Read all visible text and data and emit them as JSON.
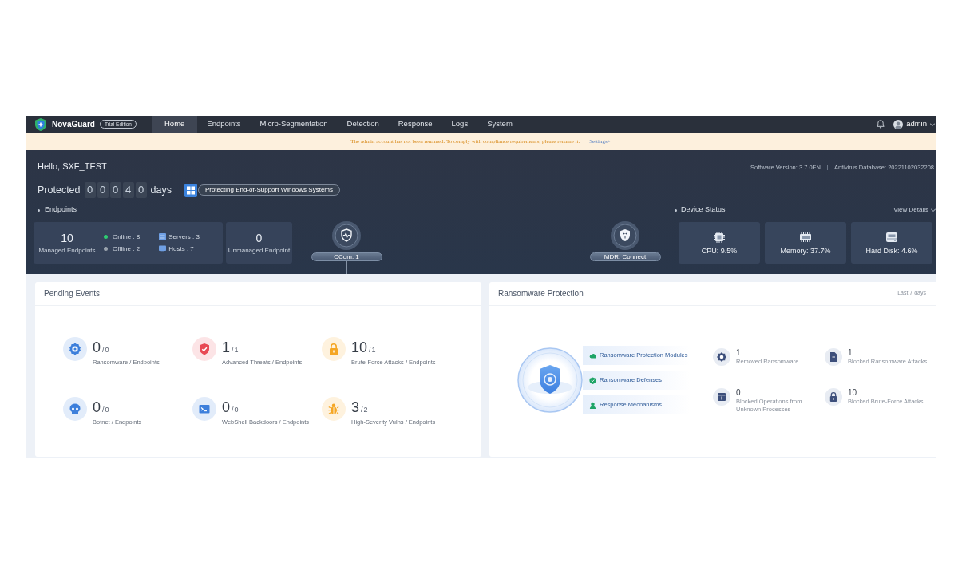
{
  "navbar": {
    "brand": "NovaGuard",
    "edition": "Trial Edition",
    "tabs": [
      {
        "label": "Home",
        "selected": true
      },
      {
        "label": "Endpoints",
        "selected": false
      },
      {
        "label": "Micro-Segmentation",
        "selected": false
      },
      {
        "label": "Detection",
        "selected": false
      },
      {
        "label": "Response",
        "selected": false
      },
      {
        "label": "Logs",
        "selected": false
      },
      {
        "label": "System",
        "selected": false
      }
    ],
    "user": "admin"
  },
  "notice": {
    "message": "The admin account has not been renamed. To comply with compliance requirements, please rename it.",
    "link": "Settings>"
  },
  "overview": {
    "greeting": "Hello, SXF_TEST",
    "software_version": "Software Version: 3.7.0EN",
    "antivirus_database": "Antivirus Database: 20221102032208",
    "protected": {
      "label": "Protected",
      "digits": [
        "0",
        "0",
        "0",
        "4",
        "0"
      ],
      "unit": "days"
    },
    "support_badge": "Protecting End-of-Support Windows Systems",
    "endpoints": {
      "title": "Endpoints",
      "managed": {
        "count": "10",
        "label": "Managed Endpoints"
      },
      "states": [
        {
          "label": "Online : 8",
          "color": "#2ecc71"
        },
        {
          "label": "Offline : 2",
          "color": "#9aa3ad"
        }
      ],
      "types": [
        {
          "kind": "server",
          "label": "Servers : 3"
        },
        {
          "kind": "host",
          "label": "Hosts : 7"
        }
      ],
      "unmanaged": {
        "count": "0",
        "label": "Unmanaged Endpoint"
      }
    },
    "connections": [
      {
        "kind": "ccom",
        "label": "CCom: 1",
        "connector": true
      },
      {
        "kind": "mdr",
        "label": "MDR: Connect",
        "connector": false
      }
    ],
    "device_status": {
      "title": "Device Status",
      "link": "View Details",
      "items": [
        {
          "kind": "cpu",
          "label": "CPU: 9.5%"
        },
        {
          "kind": "memory",
          "label": "Memory: 37.7%"
        },
        {
          "kind": "disk",
          "label": "Hard Disk: 4.6%"
        }
      ]
    }
  },
  "pending_events": {
    "title": "Pending Events",
    "items": [
      {
        "kind": "ransomware",
        "count": "0",
        "total": "/0",
        "label": "Ransomware / Endpoints",
        "color": "#3d7fdb"
      },
      {
        "kind": "advanced_threats",
        "count": "1",
        "total": "/1",
        "label": "Advanced Threats / Endpoints",
        "color": "#e84a55"
      },
      {
        "kind": "brute_force",
        "count": "10",
        "total": "/1",
        "label": "Brute-Force Attacks / Endpoints",
        "color": "#f5a623"
      },
      {
        "kind": "botnet",
        "count": "0",
        "total": "/0",
        "label": "Botnet / Endpoints",
        "color": "#3d7fdb"
      },
      {
        "kind": "webshell",
        "count": "0",
        "total": "/0",
        "label": "WebShell Backdoors / Endpoints",
        "color": "#3d7fdb"
      },
      {
        "kind": "vulns",
        "count": "3",
        "total": "/2",
        "label": "High-Severity Vulns / Endpoints",
        "color": "#f5a623"
      }
    ]
  },
  "ransomware_protection": {
    "title": "Ransomware Protection",
    "period": "Last 7 days",
    "layers": [
      {
        "kind": "modules",
        "label": "Ransomware Protection Modules"
      },
      {
        "kind": "defenses",
        "label": "Ransomware Defenses"
      },
      {
        "kind": "response",
        "label": "Response Mechanisms"
      }
    ],
    "stats": [
      {
        "kind": "removed",
        "value": "1",
        "label": "Removed Ransomware"
      },
      {
        "kind": "blocked_attacks",
        "value": "1",
        "label": "Blocked Ransomware Attacks"
      },
      {
        "kind": "blocked_operations",
        "value": "0",
        "label": "Blocked Operations from Unknown Processes"
      },
      {
        "kind": "blocked_brute_force",
        "value": "10",
        "label": "Blocked Brute-Force Attacks"
      }
    ]
  }
}
